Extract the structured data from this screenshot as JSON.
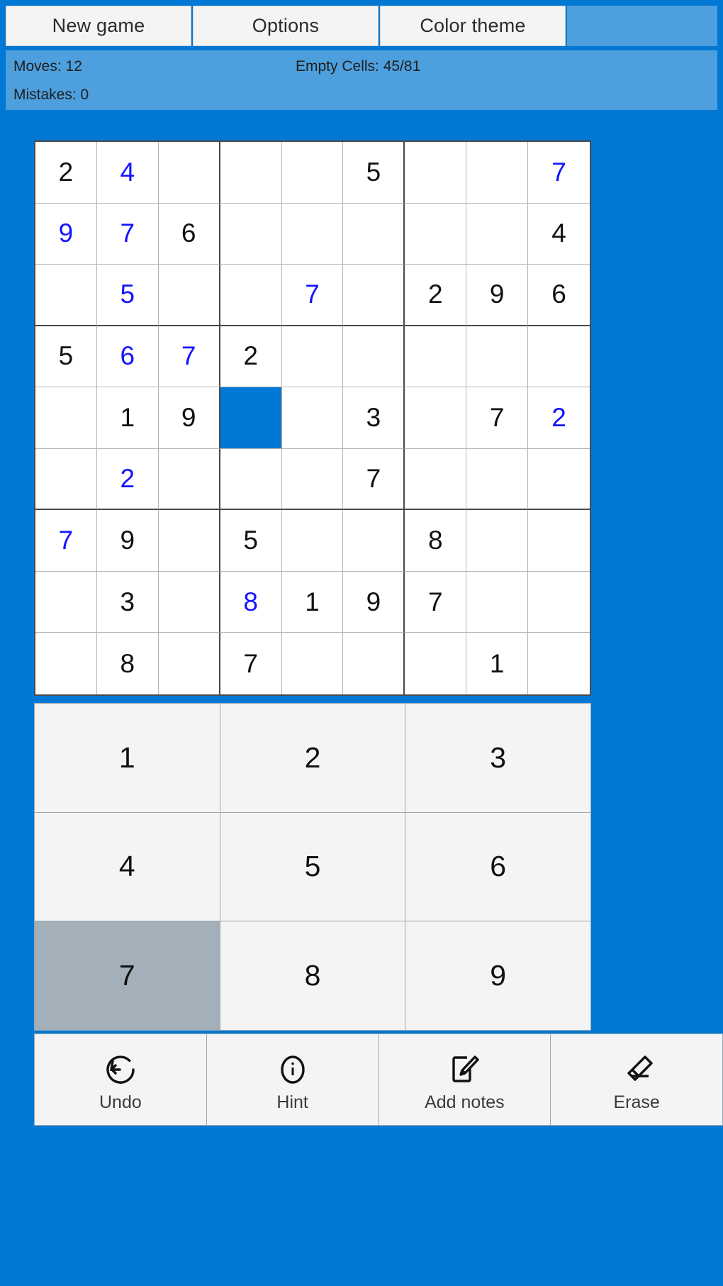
{
  "theme": {
    "background": "#0078d4",
    "panel": "#4d9fdd",
    "button_face": "#f4f4f4",
    "given_number": "#111111",
    "user_number": "#1414ff",
    "selected_cell": "#0078d4",
    "active_key": "#a3b0b9"
  },
  "menubar": {
    "buttons": [
      {
        "label": "New game",
        "name": "new-game-button"
      },
      {
        "label": "Options",
        "name": "options-button"
      },
      {
        "label": "Color theme",
        "name": "color-theme-button"
      }
    ]
  },
  "status": {
    "moves": "Moves: 12",
    "mistakes": "Mistakes: 0",
    "empty_cells": "Empty Cells: 45/81"
  },
  "board": {
    "selected": {
      "row": 4,
      "col": 3
    },
    "rows": [
      [
        {
          "v": "2",
          "t": "given"
        },
        {
          "v": "4",
          "t": "user"
        },
        {
          "v": "",
          "t": "empty"
        },
        {
          "v": "",
          "t": "empty"
        },
        {
          "v": "",
          "t": "empty"
        },
        {
          "v": "5",
          "t": "given"
        },
        {
          "v": "",
          "t": "empty"
        },
        {
          "v": "",
          "t": "empty"
        },
        {
          "v": "7",
          "t": "user"
        }
      ],
      [
        {
          "v": "9",
          "t": "user"
        },
        {
          "v": "7",
          "t": "user"
        },
        {
          "v": "6",
          "t": "given"
        },
        {
          "v": "",
          "t": "empty"
        },
        {
          "v": "",
          "t": "empty"
        },
        {
          "v": "",
          "t": "empty"
        },
        {
          "v": "",
          "t": "empty"
        },
        {
          "v": "",
          "t": "empty"
        },
        {
          "v": "4",
          "t": "given"
        }
      ],
      [
        {
          "v": "",
          "t": "empty"
        },
        {
          "v": "5",
          "t": "user"
        },
        {
          "v": "",
          "t": "empty"
        },
        {
          "v": "",
          "t": "empty"
        },
        {
          "v": "7",
          "t": "user"
        },
        {
          "v": "",
          "t": "empty"
        },
        {
          "v": "2",
          "t": "given"
        },
        {
          "v": "9",
          "t": "given"
        },
        {
          "v": "6",
          "t": "given"
        }
      ],
      [
        {
          "v": "5",
          "t": "given"
        },
        {
          "v": "6",
          "t": "user"
        },
        {
          "v": "7",
          "t": "user"
        },
        {
          "v": "2",
          "t": "given"
        },
        {
          "v": "",
          "t": "empty"
        },
        {
          "v": "",
          "t": "empty"
        },
        {
          "v": "",
          "t": "empty"
        },
        {
          "v": "",
          "t": "empty"
        },
        {
          "v": "",
          "t": "empty"
        }
      ],
      [
        {
          "v": "",
          "t": "empty"
        },
        {
          "v": "1",
          "t": "given"
        },
        {
          "v": "9",
          "t": "given"
        },
        {
          "v": "",
          "t": "selected"
        },
        {
          "v": "",
          "t": "empty"
        },
        {
          "v": "3",
          "t": "given"
        },
        {
          "v": "",
          "t": "empty"
        },
        {
          "v": "7",
          "t": "given"
        },
        {
          "v": "2",
          "t": "user"
        }
      ],
      [
        {
          "v": "",
          "t": "empty"
        },
        {
          "v": "2",
          "t": "user"
        },
        {
          "v": "",
          "t": "empty"
        },
        {
          "v": "",
          "t": "empty"
        },
        {
          "v": "",
          "t": "empty"
        },
        {
          "v": "7",
          "t": "given"
        },
        {
          "v": "",
          "t": "empty"
        },
        {
          "v": "",
          "t": "empty"
        },
        {
          "v": "",
          "t": "empty"
        }
      ],
      [
        {
          "v": "7",
          "t": "user"
        },
        {
          "v": "9",
          "t": "given"
        },
        {
          "v": "",
          "t": "empty"
        },
        {
          "v": "5",
          "t": "given"
        },
        {
          "v": "",
          "t": "empty"
        },
        {
          "v": "",
          "t": "empty"
        },
        {
          "v": "8",
          "t": "given"
        },
        {
          "v": "",
          "t": "empty"
        },
        {
          "v": "",
          "t": "empty"
        }
      ],
      [
        {
          "v": "",
          "t": "empty"
        },
        {
          "v": "3",
          "t": "given"
        },
        {
          "v": "",
          "t": "empty"
        },
        {
          "v": "8",
          "t": "user"
        },
        {
          "v": "1",
          "t": "given"
        },
        {
          "v": "9",
          "t": "given"
        },
        {
          "v": "7",
          "t": "given"
        },
        {
          "v": "",
          "t": "empty"
        },
        {
          "v": "",
          "t": "empty"
        }
      ],
      [
        {
          "v": "",
          "t": "empty"
        },
        {
          "v": "8",
          "t": "given"
        },
        {
          "v": "",
          "t": "empty"
        },
        {
          "v": "7",
          "t": "given"
        },
        {
          "v": "",
          "t": "empty"
        },
        {
          "v": "",
          "t": "empty"
        },
        {
          "v": "",
          "t": "empty"
        },
        {
          "v": "1",
          "t": "given"
        },
        {
          "v": "",
          "t": "empty"
        }
      ]
    ]
  },
  "numpad": {
    "active": "7",
    "keys": [
      "1",
      "2",
      "3",
      "4",
      "5",
      "6",
      "7",
      "8",
      "9"
    ]
  },
  "actions": [
    {
      "label": "Undo",
      "icon": "undo-icon",
      "name": "undo-button"
    },
    {
      "label": "Hint",
      "icon": "info-icon",
      "name": "hint-button"
    },
    {
      "label": "Add notes",
      "icon": "note-pencil-icon",
      "name": "add-notes-button"
    },
    {
      "label": "Erase",
      "icon": "eraser-icon",
      "name": "erase-button"
    }
  ]
}
